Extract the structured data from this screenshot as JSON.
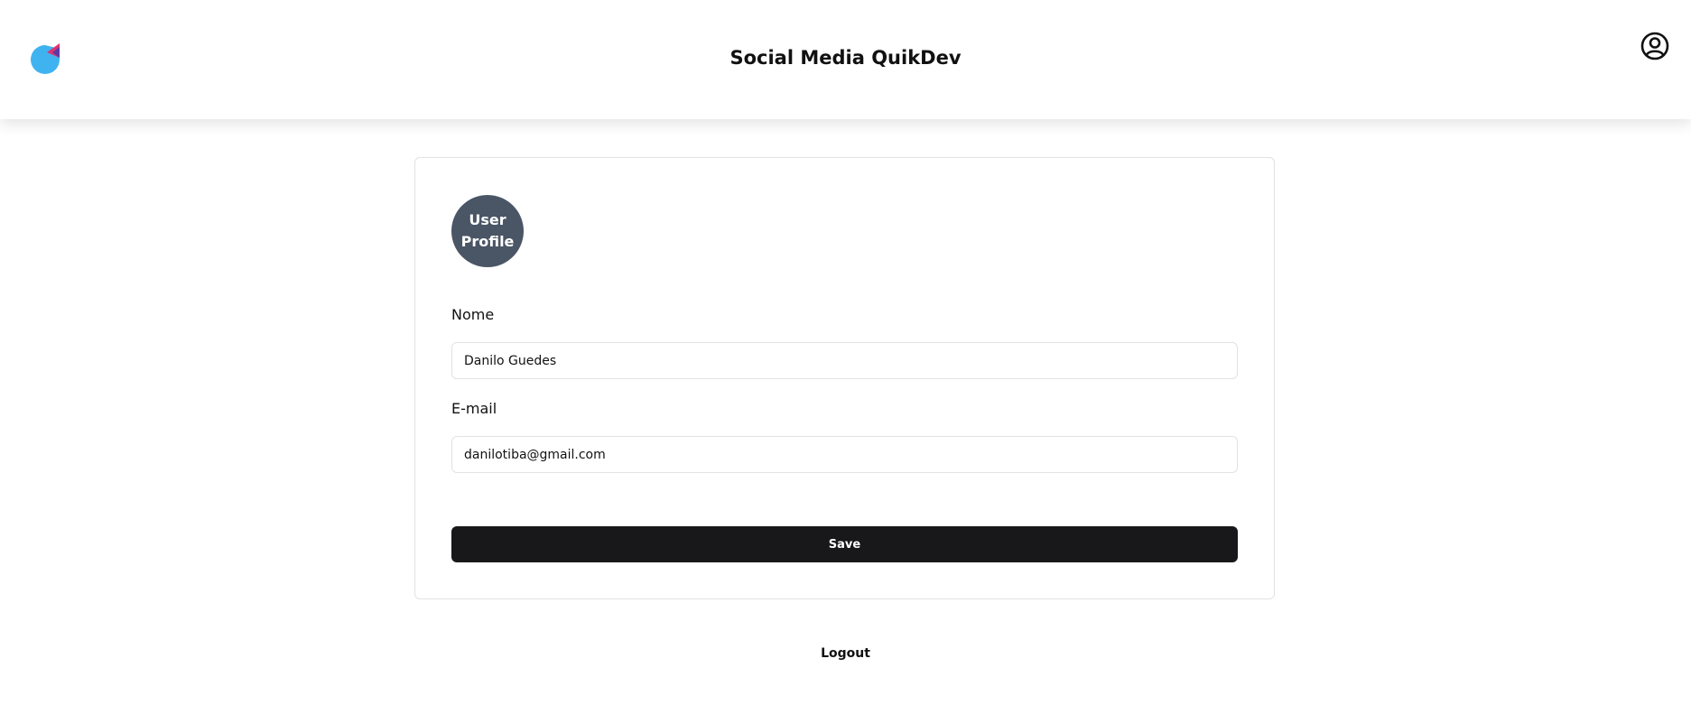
{
  "header": {
    "title": "Social Media QuikDev",
    "logo_icon": "app-logo-icon",
    "user_icon": "user-circle-icon"
  },
  "profile": {
    "avatar_text": "User Profile",
    "name_label": "Nome",
    "name_value": "Danilo Guedes",
    "email_label": "E-mail",
    "email_value": "danilotiba@gmail.com",
    "save_label": "Save"
  },
  "footer": {
    "logout_label": "Logout"
  },
  "colors": {
    "avatar_bg": "#4a5566",
    "button_bg": "#18181b",
    "logo_blue": "#3fb3f0",
    "logo_pink": "#e0326e",
    "logo_purple": "#5b3aa8"
  }
}
